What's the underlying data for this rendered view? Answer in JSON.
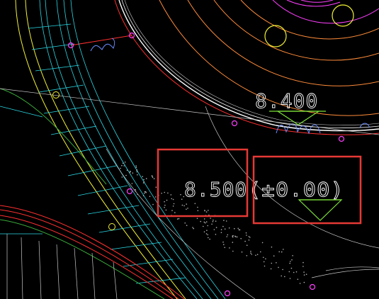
{
  "drawing": {
    "elevation_labels": [
      {
        "id": "upper",
        "text": "8.400"
      },
      {
        "id": "lower-left",
        "text": "8.500"
      },
      {
        "id": "lower-right",
        "text": "(±0.00)"
      }
    ],
    "colors": {
      "background": "#000000",
      "highlight_box": "#e53935",
      "elevation_marker": "#7cdf3a",
      "wall_lines": "#ff3030",
      "curb_lines": "#ffffff",
      "grid_lines": "#2ad8e6",
      "outer_lines": "#f2f235",
      "arc_orange": "#ff8c3a",
      "arc_magenta": "#ff40ff",
      "arc_yellow": "#f2f235",
      "node_magenta": "#ff40ff",
      "ref_lines": "#c8c8c8",
      "hatch_dots": "#b0b0b0",
      "spline_blue": "#6a8cff"
    },
    "symbols": [
      "elevation-triangle-marker",
      "pipe-node-marker",
      "circular-manhole"
    ]
  }
}
